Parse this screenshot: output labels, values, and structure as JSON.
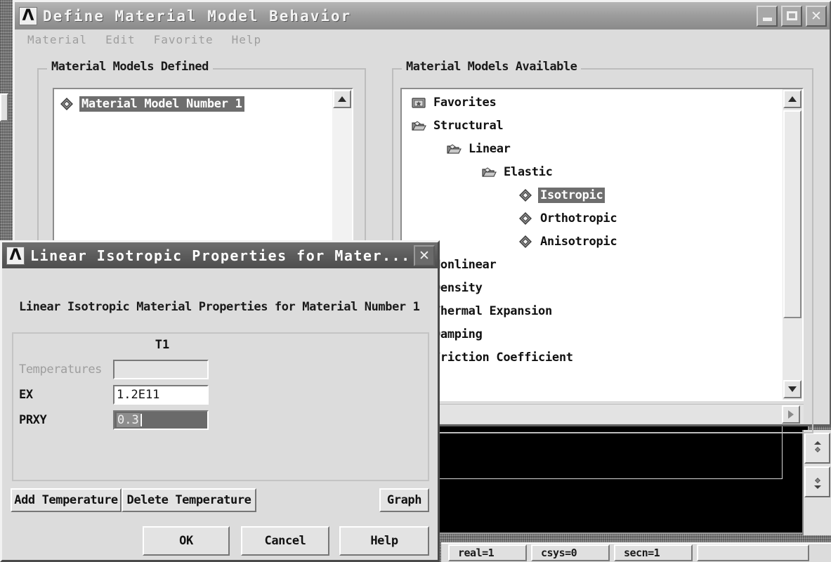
{
  "window_define": {
    "title": "Define Material Model Behavior",
    "logo": "ansys-logo-icon",
    "controls": {
      "minimize": "minimize-button",
      "maximize": "maximize-button",
      "close": "close-button"
    },
    "menu": [
      "Material",
      "Edit",
      "Favorite",
      "Help"
    ],
    "defined_group": {
      "title": "Material Models Defined",
      "items": [
        {
          "label": "Material Model Number 1",
          "icon": "diamond-icon",
          "indent": 0,
          "selected": true
        }
      ]
    },
    "available_group": {
      "title": "Material Models Available",
      "items": [
        {
          "label": "Favorites",
          "icon": "folder-star-icon",
          "indent": 0,
          "selected": false
        },
        {
          "label": "Structural",
          "icon": "folder-open-icon",
          "indent": 0,
          "selected": false
        },
        {
          "label": "Linear",
          "icon": "folder-open-icon",
          "indent": 1,
          "selected": false
        },
        {
          "label": "Elastic",
          "icon": "folder-open-icon",
          "indent": 2,
          "selected": false
        },
        {
          "label": "Isotropic",
          "icon": "diamond-icon",
          "indent": 3,
          "selected": true
        },
        {
          "label": "Orthotropic",
          "icon": "diamond-icon",
          "indent": 3,
          "selected": false
        },
        {
          "label": "Anisotropic",
          "icon": "diamond-icon",
          "indent": 3,
          "selected": false
        },
        {
          "label": "Nonlinear",
          "icon": "folder-open-icon",
          "indent": 0,
          "selected": false
        },
        {
          "label": "Density",
          "icon": "diamond-icon",
          "indent": 0,
          "selected": false
        },
        {
          "label": "Thermal Expansion",
          "icon": "folder-open-icon",
          "indent": 0,
          "selected": false
        },
        {
          "label": "Damping",
          "icon": "diamond-icon",
          "indent": 0,
          "selected": false
        },
        {
          "label": "Friction Coefficient",
          "icon": "diamond-icon",
          "indent": 0,
          "selected": false
        }
      ]
    }
  },
  "dialog_linear_isotropic": {
    "title": "Linear Isotropic Properties for Mater...",
    "logo": "ansys-logo-icon",
    "close_label": "✕",
    "heading": "Linear Isotropic Material Properties for Material Number 1",
    "column_header": "T1",
    "properties": [
      {
        "name": "Temperatures",
        "value": "",
        "disabled": true,
        "selected": false
      },
      {
        "name": "EX",
        "value": "1.2E11",
        "disabled": false,
        "selected": false
      },
      {
        "name": "PRXY",
        "value": "0.3",
        "disabled": false,
        "selected": true
      }
    ],
    "buttons": {
      "add_temperature": "Add Temperature",
      "delete_temperature": "Delete Temperature",
      "graph": "Graph",
      "ok": "OK",
      "cancel": "Cancel",
      "help": "Help"
    }
  },
  "statusbar": {
    "cells": [
      "real=1",
      "csys=0",
      "secn=1",
      ""
    ]
  },
  "side_toolbar": {
    "buttons": [
      "pan-zoom-up-icon",
      "pan-zoom-down-icon"
    ]
  },
  "colors": {
    "window_face": "#dcdcdc",
    "titlebar_active": "#9e9e9e",
    "titlebar_dialog": "#5c5c5c",
    "selection": "#6e6e6e",
    "field_selected": "#6a6a6a",
    "graphics_background": "#000000",
    "text": "#1a1a1a",
    "disabled_text": "#9e9e9e"
  }
}
